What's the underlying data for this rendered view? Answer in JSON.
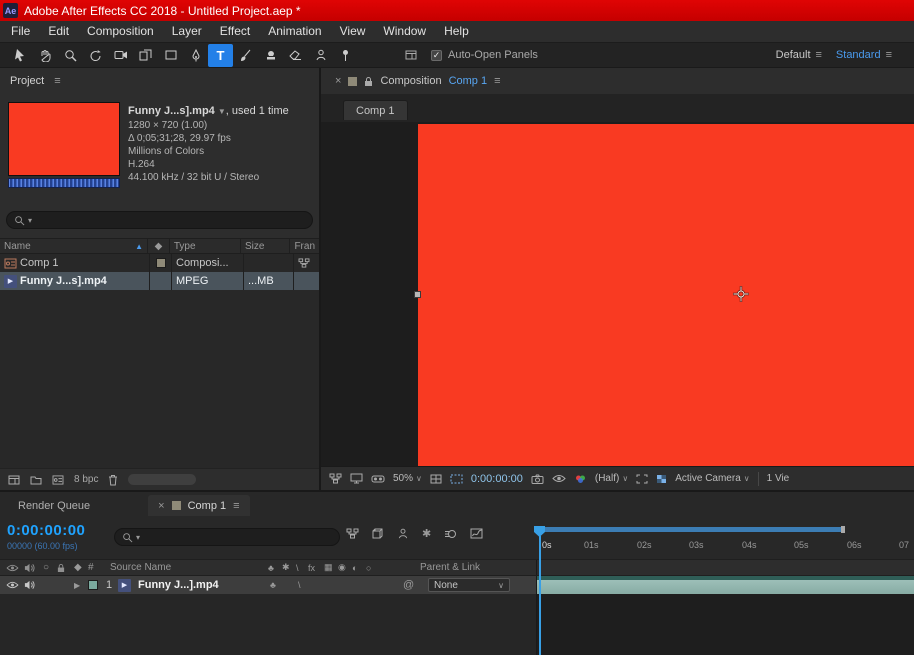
{
  "icons": {
    "menu": "≡",
    "close": "×",
    "caret_down": "∨",
    "sort_asc": "▲",
    "expander": "▶",
    "footage_play": "▶",
    "check": "✓",
    "solo": "○",
    "tag": "◆",
    "hash": "#",
    "pickwhip": "@",
    "snowflake": "✱",
    "type_tool": "T"
  },
  "title_bar": {
    "app_badge": "Ae",
    "title": "Adobe After Effects CC 2018 - Untitled Project.aep *"
  },
  "menu_bar": {
    "items": [
      "File",
      "Edit",
      "Composition",
      "Layer",
      "Effect",
      "Animation",
      "View",
      "Window",
      "Help"
    ]
  },
  "toolbar": {
    "auto_open_label": "Auto-Open Panels",
    "workspaces": {
      "default": "Default",
      "standard": "Standard"
    }
  },
  "project_panel": {
    "tab_label": "Project",
    "preview": {
      "name": "Funny J...s].mp4",
      "usage": ", used 1 time",
      "dimensions": "1280 × 720 (1.00)",
      "duration": "Δ 0;05;31;28, 29.97 fps",
      "colors": "Millions of Colors",
      "codec": "H.264",
      "audio": "44.100 kHz / 32 bit U / Stereo"
    },
    "columns": {
      "name": "Name",
      "type": "Type",
      "size": "Size",
      "frame": "Fran"
    },
    "rows": [
      {
        "name": "Comp 1",
        "type": "Composi...",
        "size": ""
      },
      {
        "name": "Funny J...s].mp4",
        "type": "MPEG",
        "size": "...MB"
      }
    ],
    "footer": {
      "bpc": "8 bpc"
    }
  },
  "comp_panel": {
    "header": {
      "panel_label": "Composition",
      "comp_name": "Comp 1"
    },
    "tab_label": "Comp 1",
    "toolbar": {
      "zoom": "50%",
      "timecode": "0:00:00:00",
      "resolution": "(Half)",
      "camera": "Active Camera",
      "view_layout": "1 Vie"
    }
  },
  "timeline_panel": {
    "tabs": {
      "render_queue": "Render Queue",
      "comp": "Comp 1"
    },
    "timecode": "0:00:00:00",
    "frame_info": "00000 (60.00 fps)",
    "ruler": [
      "0s",
      "01s",
      "02s",
      "03s",
      "04s",
      "05s",
      "06s",
      "07"
    ],
    "columns": {
      "source_name": "Source Name",
      "parent_link": "Parent & Link"
    },
    "switch_glyphs": [
      "♣",
      "✱",
      "\\",
      "fx",
      "▦",
      "◉",
      "◐",
      "○"
    ],
    "layer": {
      "index": "1",
      "name": "Funny J...].mp4",
      "parent_value": "None"
    }
  },
  "colors": {
    "accent_blue": "#2d8ceb",
    "timecode_blue": "#1fa3ff",
    "comp_red": "#f93a22",
    "layer_teal": "#8fb3ac",
    "titlebar_red": "#d20000"
  }
}
